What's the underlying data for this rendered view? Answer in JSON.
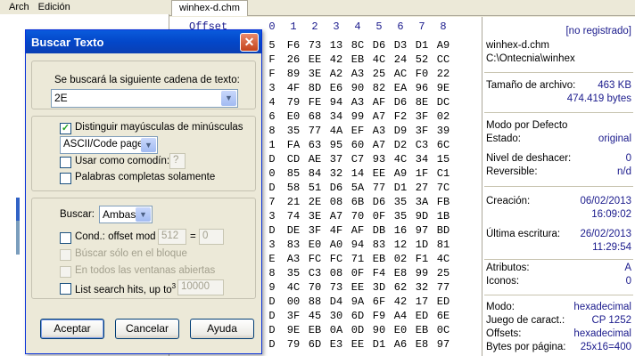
{
  "menubar": {
    "items": [
      "Arch",
      "Edición"
    ]
  },
  "tab": {
    "label": "winhex-d.chm"
  },
  "hex": {
    "offset_label": "Offset",
    "columns": [
      "0",
      "1",
      "2",
      "3",
      "4",
      "5",
      "6",
      "7",
      "8"
    ],
    "rows": [
      [
        "5",
        "F6",
        "73",
        "13",
        "8C",
        "D6",
        "D3",
        "D1",
        "A9"
      ],
      [
        "F",
        "26",
        "EE",
        "42",
        "EB",
        "4C",
        "24",
        "52",
        "CC"
      ],
      [
        "F",
        "89",
        "3E",
        "A2",
        "A3",
        "25",
        "AC",
        "F0",
        "22"
      ],
      [
        "3",
        "4F",
        "8D",
        "E6",
        "90",
        "82",
        "EA",
        "96",
        "9E"
      ],
      [
        "4",
        "79",
        "FE",
        "94",
        "A3",
        "AF",
        "D6",
        "8E",
        "DC"
      ],
      [
        "6",
        "E0",
        "68",
        "34",
        "99",
        "A7",
        "F2",
        "3F",
        "02"
      ],
      [
        "8",
        "35",
        "77",
        "4A",
        "EF",
        "A3",
        "D9",
        "3F",
        "39"
      ],
      [
        "1",
        "FA",
        "63",
        "95",
        "60",
        "A7",
        "D2",
        "C3",
        "6C"
      ],
      [
        "D",
        "CD",
        "AE",
        "37",
        "C7",
        "93",
        "4C",
        "34",
        "15"
      ],
      [
        "0",
        "85",
        "84",
        "32",
        "14",
        "EE",
        "A9",
        "1F",
        "C1"
      ],
      [
        "D",
        "58",
        "51",
        "D6",
        "5A",
        "77",
        "D1",
        "27",
        "7C"
      ],
      [
        "7",
        "21",
        "2E",
        "08",
        "6B",
        "D6",
        "35",
        "3A",
        "FB"
      ],
      [
        "3",
        "74",
        "3E",
        "A7",
        "70",
        "0F",
        "35",
        "9D",
        "1B"
      ],
      [
        "D",
        "DE",
        "3F",
        "4F",
        "AF",
        "DB",
        "16",
        "97",
        "BD"
      ],
      [
        "3",
        "83",
        "E0",
        "A0",
        "94",
        "83",
        "12",
        "1D",
        "81"
      ],
      [
        "E",
        "A3",
        "FC",
        "FC",
        "71",
        "EB",
        "02",
        "F1",
        "4C"
      ],
      [
        "8",
        "35",
        "C3",
        "08",
        "0F",
        "F4",
        "E8",
        "99",
        "25"
      ],
      [
        "9",
        "4C",
        "70",
        "73",
        "EE",
        "3D",
        "62",
        "32",
        "77"
      ],
      [
        "D",
        "00",
        "88",
        "D4",
        "9A",
        "6F",
        "42",
        "17",
        "ED"
      ],
      [
        "D",
        "3F",
        "45",
        "30",
        "6D",
        "F9",
        "A4",
        "ED",
        "6E"
      ],
      [
        "D",
        "9E",
        "EB",
        "0A",
        "0D",
        "90",
        "E0",
        "EB",
        "0C"
      ],
      [
        "D",
        "79",
        "6D",
        "E3",
        "EE",
        "D1",
        "A6",
        "E8",
        "97"
      ]
    ]
  },
  "info": {
    "reg": "[no registrado]",
    "filename": "winhex-d.chm",
    "path": "C:\\Ontecnia\\winhex",
    "size_label": "Tamaño de archivo:",
    "size_kb": "463 KB",
    "size_bytes": "474.419 bytes",
    "mode_label": "Modo por Defecto",
    "state_label": "Estado:",
    "state_value": "original",
    "undo_label": "Nivel de deshacer:",
    "undo_value": "0",
    "reversible_label": "Reversible:",
    "reversible_value": "n/d",
    "created_label": "Creación:",
    "created_date": "06/02/2013",
    "created_time": "16:09:02",
    "written_label": "Última escritura:",
    "written_date": "26/02/2013",
    "written_time": "11:29:54",
    "attr_label": "Atributos:",
    "attr_value": "A",
    "icons_label": "Iconos:",
    "icons_value": "0",
    "mode2_label": "Modo:",
    "mode2_value": "hexadecimal",
    "charset_label": "Juego de caract.:",
    "charset_value": "CP 1252",
    "offsets_label": "Offsets:",
    "offsets_value": "hexadecimal",
    "bpp_label": "Bytes por página:",
    "bpp_value": "25x16=400"
  },
  "dialog": {
    "title": "Buscar Texto",
    "prompt": "Se buscará la siguiente cadena de texto:",
    "search_value": "2E",
    "match_case": "Distinguir mayúsculas de minúsculas",
    "encoding": "ASCII/Code page",
    "wildcard": "Usar como comodín:",
    "wildcard_char": "?",
    "whole_words": "Palabras completas solamente",
    "search_label": "Buscar:",
    "direction": "Ambas",
    "cond": "Cond.: offset mod",
    "cond_mod": "512",
    "cond_eq": "=",
    "cond_val": "0",
    "block_only": "Búscar sólo en el bloque",
    "all_windows": "En todos las ventanas abiertas",
    "list_hits": "List search hits, up to",
    "list_hits_sup": "3",
    "list_hits_val": "10000",
    "ok": "Aceptar",
    "cancel": "Cancelar",
    "help": "Ayuda"
  }
}
